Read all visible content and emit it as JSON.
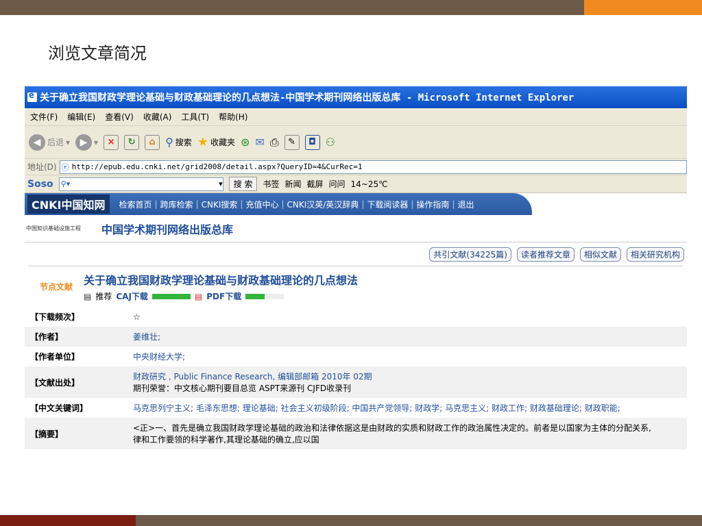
{
  "slide": {
    "title": "浏览文章简况"
  },
  "window": {
    "title": "关于确立我国财政学理论基础与财政基础理论的几点想法-中国学术期刊网络出版总库 - Microsoft Internet Explorer"
  },
  "menu": [
    "文件(F)",
    "编辑(E)",
    "查看(V)",
    "收藏(A)",
    "工具(T)",
    "帮助(H)"
  ],
  "toolbar": {
    "back": "后退",
    "search": "搜索",
    "favorites": "收藏夹"
  },
  "address": {
    "label": "地址(D)",
    "url": "http://epub.edu.cnki.net/grid2008/detail.aspx?QueryID=4&CurRec=1"
  },
  "soso": {
    "logo": "Soso",
    "search_button": "搜 索",
    "items": [
      "书签",
      "新闻",
      "截屏",
      "问问",
      "14~25℃"
    ]
  },
  "cnki": {
    "logo": "CNKI中国知网",
    "nav": [
      "检索首页",
      "跨库检索",
      "CNKI搜索",
      "充值中心",
      "CNKI汉英/英汉辞典",
      "下载阅读器",
      "操作指南",
      "退出"
    ]
  },
  "brand": {
    "small": "中国知识基础设施工程",
    "main": "中国学术期刊网络出版总库"
  },
  "links": [
    "共引文献(34225篇)",
    "读者推荐文章",
    "相似文献",
    "相关研究机构"
  ],
  "article": {
    "badge": "节点文献",
    "title": "关于确立我国财政学理论基础与财政基础理论的几点想法",
    "recommend": "推荐",
    "caj": "CAJ下载",
    "caj_progress": 1.0,
    "pdf": "PDF下载",
    "pdf_progress": 0.5
  },
  "info": {
    "rows": [
      {
        "label": "【下载频次】",
        "value": "☆"
      },
      {
        "label": "【作者】",
        "value": "姜维壮;"
      },
      {
        "label": "【作者单位】",
        "value": "中央财经大学;"
      },
      {
        "label": "【文献出处】",
        "value": "财政研究 , Public Finance Research, 编辑部邮箱 2010年 02期",
        "value2": "期刊荣誉：中文核心期刊要目总览 ASPT来源刊 CJFD收录刊"
      },
      {
        "label": "【中文关键词】",
        "value": "马克思列宁主义; 毛泽东思想; 理论基础; 社会主义初级阶段; 中国共产党领导; 财政学; 马克思主义; 财政工作; 财政基础理论; 财政职能;"
      },
      {
        "label": "【摘要】",
        "value": "<正>一、首先是确立我国财政学理论基础的政治和法律依据这是由财政的实质和财政工作的政治属性决定的。前者是以国家为主体的分配关系,",
        "value2": "律和工作要领的科学著作,其理论基础的确立,应以国"
      }
    ]
  }
}
